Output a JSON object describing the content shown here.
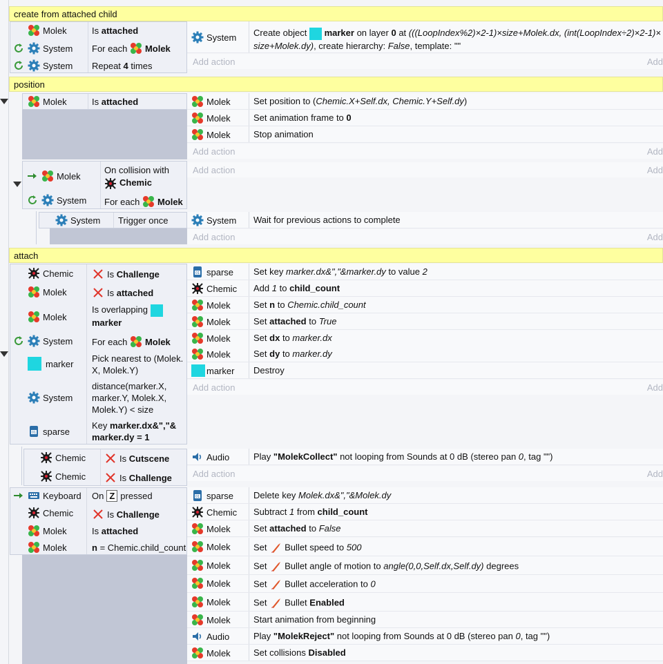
{
  "groups": {
    "g1": "create from attached child",
    "g2": "position",
    "g3": "attach"
  },
  "add_action": "Add action",
  "add_short": "Add",
  "objects": {
    "molek": "Molek",
    "system": "System",
    "chemic": "Chemic",
    "sparse": "sparse",
    "marker": "marker",
    "audio": "Audio",
    "keyboard": "Keyboard"
  },
  "g1": {
    "cond1_pre": "Is",
    "cond1_b": "attached",
    "cond2_pre": "For each",
    "cond2_b": "Molek",
    "cond3_pre": "Repeat",
    "cond3_b": "4",
    "cond3_post": "times",
    "act1_pre": "Create object",
    "act1_b1": "marker",
    "act1_mid": "on layer",
    "act1_b2": "0",
    "act1_at": "at",
    "act1_line1_i": "(((LoopIndex%2)×2-1)×size+Molek.dx, (int(LoopIndex÷2)×2-1)×",
    "act1_line2_i": "size+Molek.dy)",
    "act1_line2_post": ", create hierarchy:",
    "act1_false": "False",
    "act1_tpl": ", template: \"\""
  },
  "g2": {
    "cond1_pre": "Is",
    "cond1_b": "attached",
    "act1_pre": "Set position to (",
    "act1_i": "Chemic.X+Self.dx, Chemic.Y+Self.dy",
    "act1_post": ")",
    "act2_pre": "Set animation frame to",
    "act2_b": "0",
    "act3": "Stop animation",
    "sub_cond1_a": "On collision with",
    "sub_cond1_b": "Chemic",
    "sub_cond2_pre": "For each",
    "sub_cond2_b": "Molek",
    "sub2_cond": "Trigger once",
    "sub2_act": "Wait for previous actions to complete"
  },
  "g3": {
    "c1_pre": "Is",
    "c1_b": "Challenge",
    "c2_pre": "Is",
    "c2_b": "attached",
    "c3_a": "Is overlapping",
    "c3_b": "marker",
    "c4_pre": "For each",
    "c4_b": "Molek",
    "c5_l1": "Pick nearest to (Molek.",
    "c5_l2": "X, Molek.Y)",
    "c6_l1": "distance(marker.X,",
    "c6_l2": "marker.Y, Molek.X,",
    "c6_l3": "Molek.Y) < size",
    "c7_pre": "Key",
    "c7_b1": "marker.dx&\",\"&",
    "c7_b2": "marker.dy",
    "c7_post": "= 1",
    "a1_pre": "Set key",
    "a1_i": "marker.dx&\",\"&marker.dy",
    "a1_mid": "to value",
    "a1_v": "2",
    "a2_pre": "Add",
    "a2_i": "1",
    "a2_mid": "to",
    "a2_b": "child_count",
    "a3_pre": "Set",
    "a3_b": "n",
    "a3_mid": "to",
    "a3_i": "Chemic.child_count",
    "a4_pre": "Set",
    "a4_b": "attached",
    "a4_mid": "to",
    "a4_i": "True",
    "a5_pre": "Set",
    "a5_b": "dx",
    "a5_mid": "to",
    "a5_i": "marker.dx",
    "a6_pre": "Set",
    "a6_b": "dy",
    "a6_mid": "to",
    "a6_i": "marker.dy",
    "a7": "Destroy",
    "s1_c1_pre": "Is",
    "s1_c1_b": "Cutscene",
    "s1_c2_pre": "Is",
    "s1_c2_b": "Challenge",
    "s1_a1_pre": "Play",
    "s1_a1_b": "\"MolekCollect\"",
    "s1_a1_mid": "not looping from Sounds at 0 dB (stereo pan",
    "s1_a1_i": "0",
    "s1_a1_post": ", tag \"\")",
    "s2_c1_pre": "On",
    "s2_c1_key": "Z",
    "s2_c1_post": "pressed",
    "s2_c2_pre": "Is",
    "s2_c2_b": "Challenge",
    "s2_c3_pre": "Is",
    "s2_c3_b": "attached",
    "s2_c4_b": "n",
    "s2_c4_post": "= Chemic.child_count",
    "s2_a1_pre": "Delete key",
    "s2_a1_i": "Molek.dx&\",\"&Molek.dy",
    "s2_a2_pre": "Subtract",
    "s2_a2_i": "1",
    "s2_a2_mid": "from",
    "s2_a2_b": "child_count",
    "s2_a3_pre": "Set",
    "s2_a3_b": "attached",
    "s2_a3_mid": "to",
    "s2_a3_i": "False",
    "s2_a4_pre": "Set",
    "s2_a4_mid": "Bullet speed to",
    "s2_a4_i": "500",
    "s2_a5_pre": "Set",
    "s2_a5_mid": "Bullet angle of motion to",
    "s2_a5_i": "angle(0,0,Self.dx,Self.dy)",
    "s2_a5_post": "degrees",
    "s2_a6_pre": "Set",
    "s2_a6_mid": "Bullet acceleration to",
    "s2_a6_i": "0",
    "s2_a7_pre": "Set",
    "s2_a7_mid": "Bullet",
    "s2_a7_b": "Enabled",
    "s2_a8": "Start animation from beginning",
    "s2_a9_pre": "Play",
    "s2_a9_b": "\"MolekReject\"",
    "s2_a9_mid": "not looping from Sounds at 0 dB (stereo pan",
    "s2_a9_i": "0",
    "s2_a9_post": ", tag \"\")",
    "s2_a10_pre": "Set collisions",
    "s2_a10_b": "Disabled"
  },
  "colors": {
    "group_bar": "#feff9f",
    "marker": "#1fd6e0",
    "slate": "#c1c6d5",
    "invert_x": "#e0352b"
  }
}
